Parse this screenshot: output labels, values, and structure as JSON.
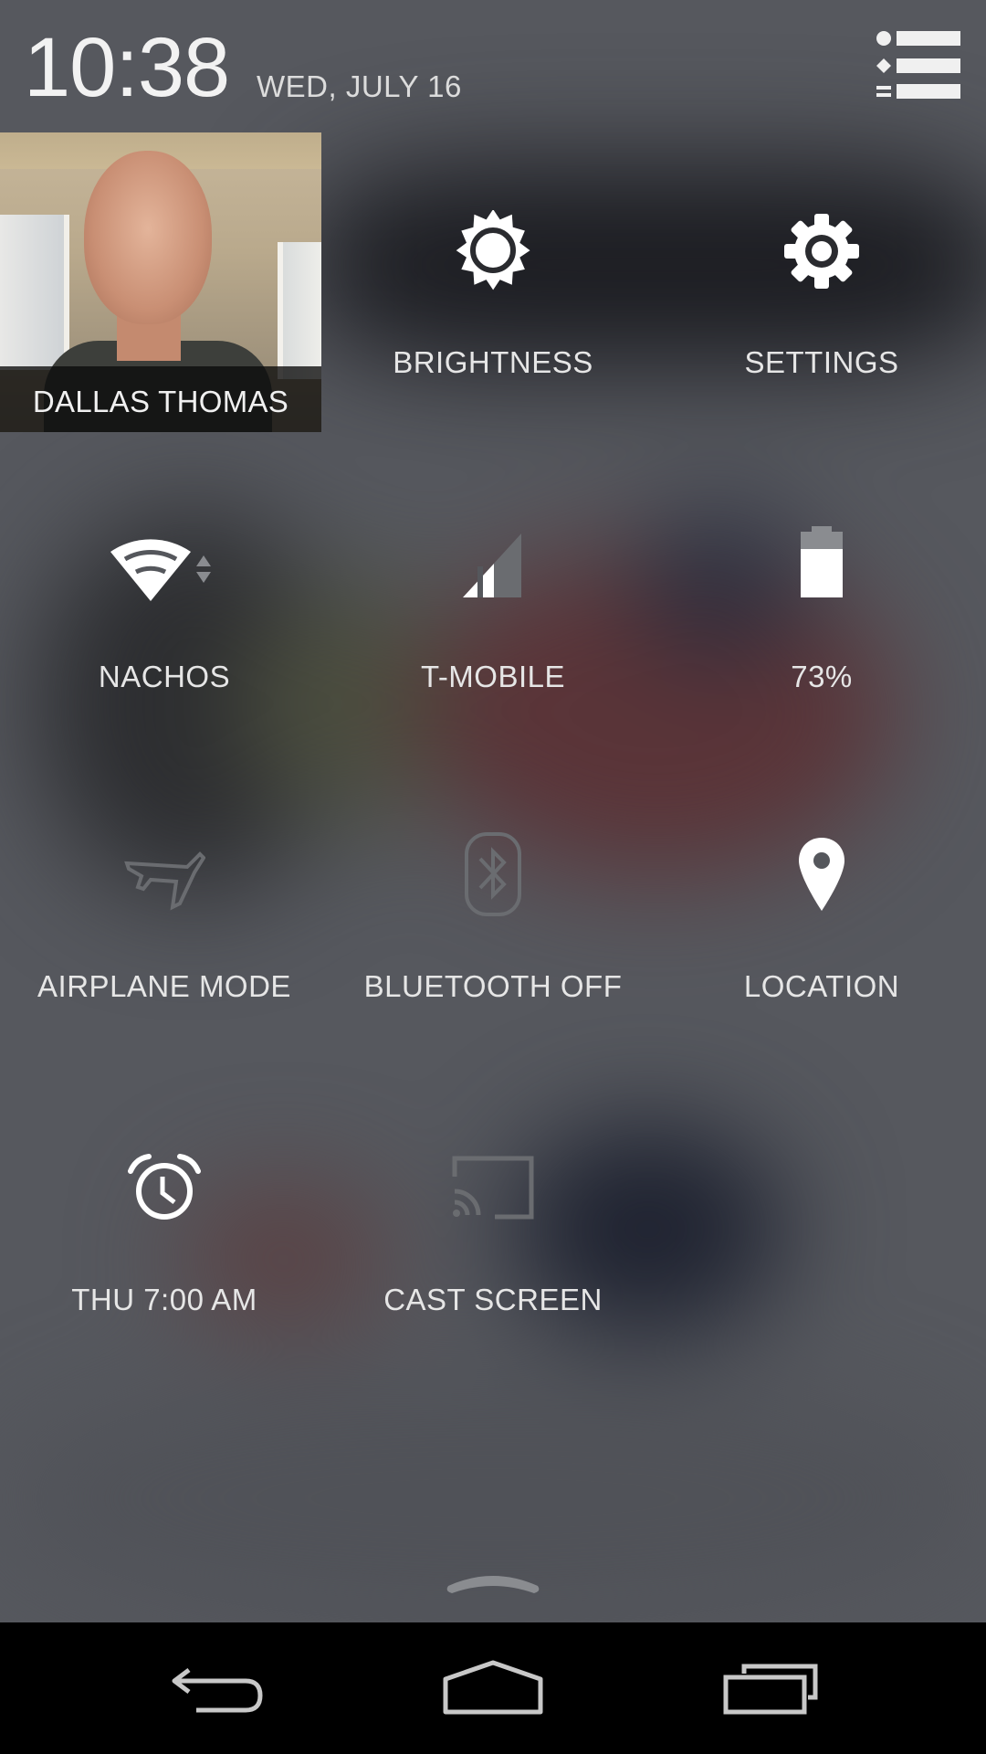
{
  "header": {
    "time": "10:38",
    "date": "WED, JULY 16"
  },
  "user": {
    "name": "DALLAS THOMAS"
  },
  "tiles": {
    "brightness": {
      "label": "BRIGHTNESS",
      "icon": "brightness-icon"
    },
    "settings": {
      "label": "SETTINGS",
      "icon": "gear-icon"
    },
    "wifi": {
      "label": "NACHOS",
      "icon": "wifi-icon"
    },
    "cellular": {
      "label": "T-MOBILE",
      "icon": "signal-icon"
    },
    "battery": {
      "label": "73%",
      "icon": "battery-icon",
      "level": 0.73
    },
    "airplane": {
      "label": "AIRPLANE MODE",
      "icon": "airplane-icon",
      "active": false
    },
    "bluetooth": {
      "label": "BLUETOOTH OFF",
      "icon": "bluetooth-icon",
      "active": false
    },
    "location": {
      "label": "LOCATION",
      "icon": "location-pin-icon",
      "active": true
    },
    "alarm": {
      "label": "THU 7:00 AM",
      "icon": "alarm-clock-icon"
    },
    "cast": {
      "label": "CAST SCREEN",
      "icon": "cast-icon",
      "active": false
    }
  },
  "navbar": {
    "back_icon": "back-icon",
    "home_icon": "home-icon",
    "recents_icon": "recents-icon"
  },
  "colors": {
    "active_icon": "#ffffff",
    "inactive_icon": "#6a6c70",
    "label": "#e6e6e6",
    "navbar": "#000000"
  }
}
